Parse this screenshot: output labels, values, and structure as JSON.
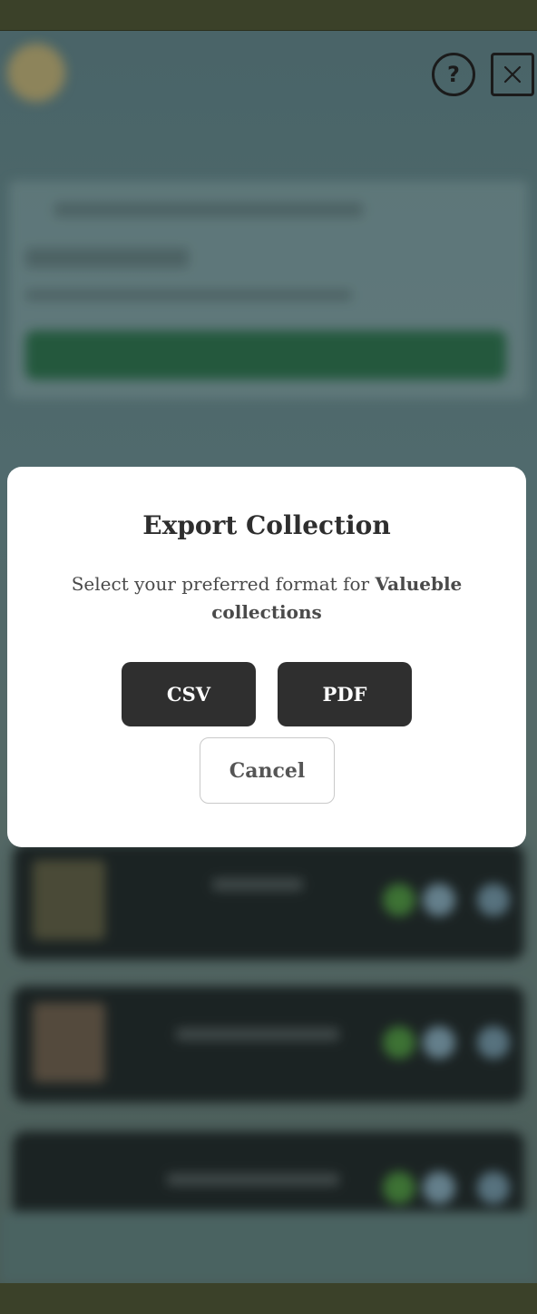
{
  "header": {
    "help_glyph": "?",
    "help_icon": "question-mark-icon",
    "close_icon": "close-x-icon"
  },
  "dialog": {
    "title": "Export Collection",
    "description_prefix": "Select your preferred format for ",
    "collection_name": "Valueble collections",
    "buttons": {
      "csv": "CSV",
      "pdf": "PDF",
      "cancel": "Cancel"
    }
  },
  "colors": {
    "dark_button": "#2f2f2f",
    "frame_olive": "#3b4129",
    "app_background": "#557174"
  }
}
